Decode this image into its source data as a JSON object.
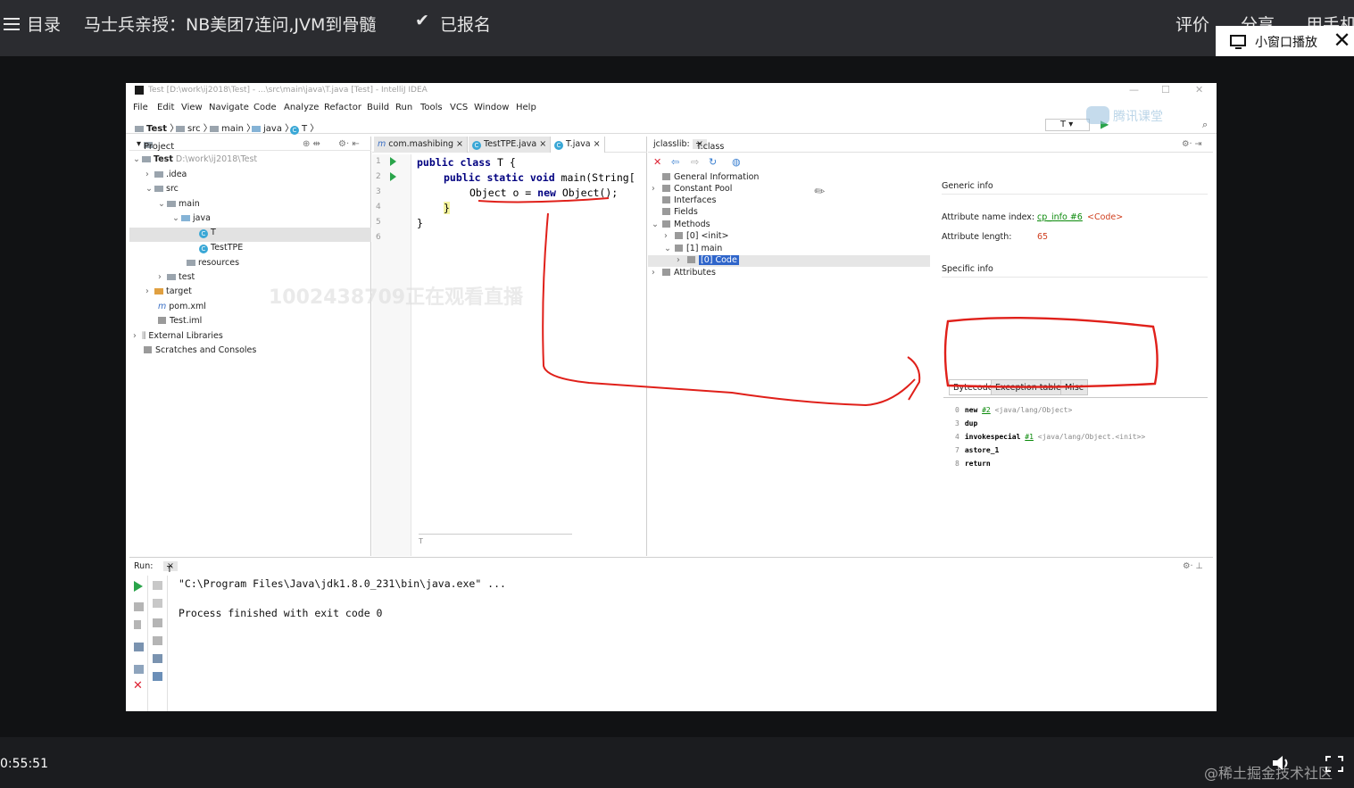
{
  "player": {
    "menu_label": "目录",
    "course_title": "马士兵亲授：NB美团7连问,JVM到骨髓",
    "enrolled": "已报名",
    "rate": "评价",
    "share": "分享",
    "phone": "用手机",
    "pip": "小窗口播放",
    "time": "0:55:51",
    "credit": "@稀土掘金技术社区",
    "overlay_watermark": "1002438709正在观看直播",
    "logo_watermark": "腾讯课堂"
  },
  "ide": {
    "title": "Test [D:\\work\\ij2018\\Test] - ...\\src\\main\\java\\T.java [Test] - IntelliJ IDEA",
    "menu": [
      "File",
      "Edit",
      "View",
      "Navigate",
      "Code",
      "Analyze",
      "Refactor",
      "Build",
      "Run",
      "Tools",
      "VCS",
      "Window",
      "Help"
    ],
    "breadcrumb": [
      "Test",
      "src",
      "main",
      "java",
      "T"
    ],
    "run_config": "T",
    "project": {
      "header": "Project",
      "root": "Test",
      "root_path": "D:\\work\\ij2018\\Test",
      "items": [
        ".idea",
        "src",
        "main",
        "java",
        "T",
        "TestTPE",
        "resources",
        "test",
        "target",
        "pom.xml",
        "Test.iml",
        "External Libraries",
        "Scratches and Consoles"
      ]
    },
    "editor": {
      "tabs": [
        "com.mashibing",
        "TestTPE.java",
        "T.java"
      ],
      "lines": [
        "1",
        "2",
        "3",
        "4",
        "5",
        "6"
      ],
      "code": {
        "l1_kw": "public class",
        "l1_rest": " T {",
        "l2_kw": "public static void",
        "l2_rest": " main(String[",
        "l3_a": "Object o = ",
        "l3_kw": "new",
        "l3_b": " Object();",
        "l4": "}",
        "l5": "}"
      },
      "footer": "T"
    },
    "jclasslib": {
      "header": "jclasslib:",
      "tab": "T.class",
      "tree": [
        "General Information",
        "Constant Pool",
        "Interfaces",
        "Fields",
        "Methods",
        "[0] <init>",
        "[1] main",
        "[0] Code",
        "Attributes"
      ],
      "generic_info": "Generic info",
      "attr_name_label": "Attribute name index:",
      "attr_name_link": "cp_info #6",
      "attr_name_value": "<Code>",
      "attr_len_label": "Attribute length:",
      "attr_len_value": "65",
      "specific_info": "Specific info",
      "bytecode_tabs": [
        "Bytecode",
        "Exception table",
        "Misc"
      ],
      "bytecode": [
        {
          "n": "0",
          "op": "new",
          "ref": "#2",
          "arg": "<java/lang/Object>"
        },
        {
          "n": "3",
          "op": "dup",
          "ref": "",
          "arg": ""
        },
        {
          "n": "4",
          "op": "invokespecial",
          "ref": "#1",
          "arg": "<java/lang/Object.<init>>"
        },
        {
          "n": "7",
          "op": "astore_1",
          "ref": "",
          "arg": ""
        },
        {
          "n": "8",
          "op": "return",
          "ref": "",
          "arg": ""
        }
      ]
    },
    "run": {
      "label": "Run:",
      "tab": "T",
      "line1": "\"C:\\Program Files\\Java\\jdk1.8.0_231\\bin\\java.exe\" ...",
      "line2": "Process finished with exit code 0"
    }
  },
  "colors": {
    "annotation": "#e0201a",
    "selection": "#2f65ca",
    "keyword": "#000080"
  }
}
